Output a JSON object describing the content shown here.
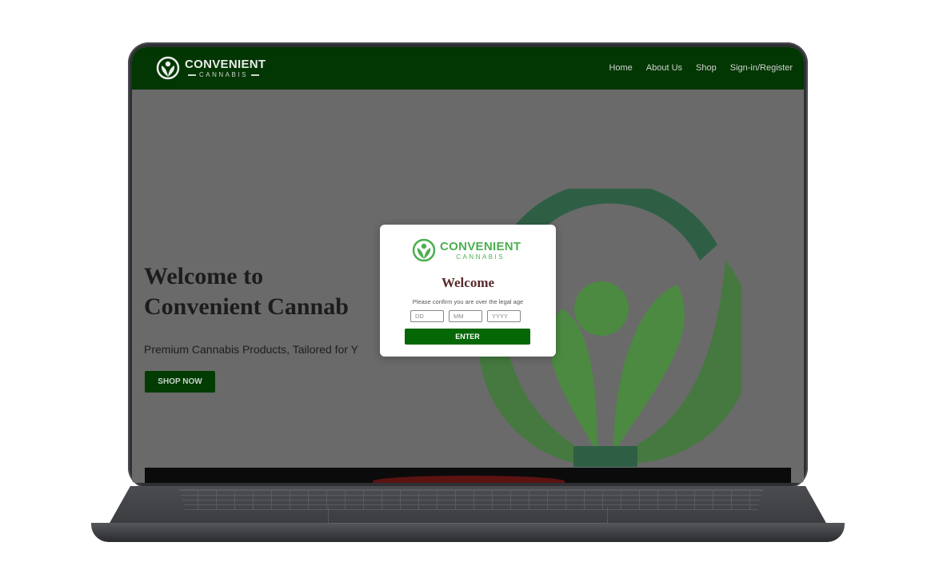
{
  "nav": {
    "brand_main": "CONVENIENT",
    "brand_sub": "CANNABIS",
    "links": [
      "Home",
      "About Us",
      "Shop",
      "Sign-in/Register"
    ]
  },
  "hero": {
    "title": "Welcome to\nConvenient Cannab",
    "subtitle": "Premium Cannabis Products, Tailored for Y",
    "cta": "SHOP NOW"
  },
  "modal": {
    "brand_main": "CONVENIENT",
    "brand_sub": "CANNABIS",
    "title": "Welcome",
    "text": "Please confirm you are over the legal age",
    "day_placeholder": "DD",
    "month_placeholder": "MM",
    "year_placeholder": "YYYY",
    "enter_label": "ENTER"
  },
  "colors": {
    "nav_bg": "#023602",
    "brand_green": "#4caf50",
    "button_green": "#056705",
    "overlay": "#6a6a6a"
  }
}
